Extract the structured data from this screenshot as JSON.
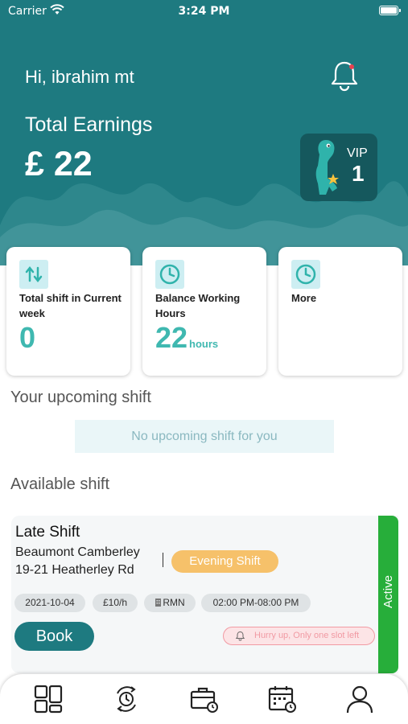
{
  "status_bar": {
    "carrier": "Carrier",
    "time": "3:24 PM"
  },
  "header": {
    "greeting": "Hi, ibrahim mt",
    "earnings_label": "Total Earnings",
    "earnings_value": "£ 22",
    "vip": {
      "label": "VIP",
      "level": "1"
    }
  },
  "stats": [
    {
      "label": "Total shift in Current week",
      "value": "0",
      "unit": ""
    },
    {
      "label": "Balance Working Hours",
      "value": "22",
      "unit": "hours"
    },
    {
      "label": "More",
      "value": "",
      "unit": ""
    }
  ],
  "upcoming": {
    "title": "Your upcoming shift",
    "empty_text": "No upcoming shift for you"
  },
  "available": {
    "title": "Available shift",
    "shifts": [
      {
        "name": "Late Shift",
        "location_line1": "Beaumont Camberley",
        "location_line2": "19-21 Heatherley Rd",
        "period": "Evening Shift",
        "date": "2021-10-04",
        "rate": "£10/h",
        "role": "RMN",
        "time": "02:00 PM-08:00 PM",
        "book_label": "Book",
        "hurry_text": "Hurry up, Only one slot left",
        "status": "Active"
      }
    ]
  },
  "tab_bar": [
    "dashboard-icon",
    "shift-swap-icon",
    "jobs-icon",
    "calendar-icon",
    "profile-icon"
  ],
  "colors": {
    "primary": "#1e7a80",
    "accent": "#3fb8b0",
    "active": "#27ae3a",
    "evening": "#f6c16a",
    "hurry": "#f19aa3"
  }
}
